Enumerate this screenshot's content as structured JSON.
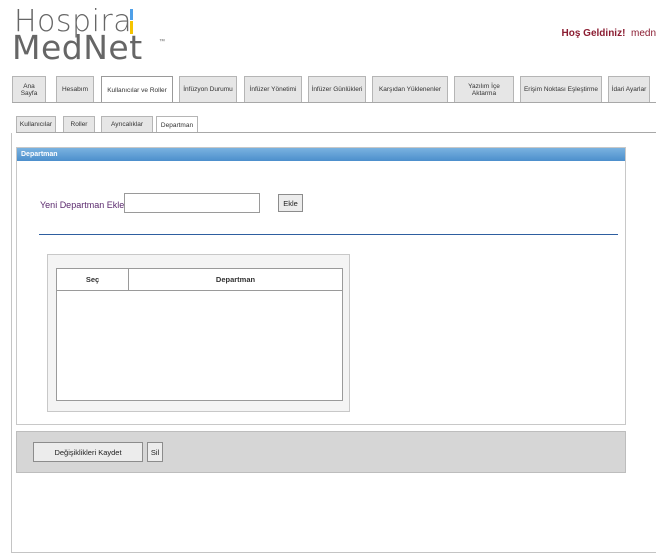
{
  "header": {
    "logo_line1": "Hospira",
    "logo_line2": "MedNet",
    "logo_tm": "™",
    "welcome_label": "Hoş Geldiniz!",
    "username": "medn"
  },
  "main_tabs": [
    {
      "label": "Ana Sayfa"
    },
    {
      "label": "Hesabım"
    },
    {
      "label": "Kullanıcılar ve Roller"
    },
    {
      "label": "İnfüzyon Durumu"
    },
    {
      "label": "İnfüzer Yönetimi"
    },
    {
      "label": "İnfüzer Günlükleri"
    },
    {
      "label": "Karşıdan Yüklenenler"
    },
    {
      "label": "Yazılım İçe Aktarma"
    },
    {
      "label": "Erişim Noktası Eşleştirme"
    },
    {
      "label": "İdari Ayarlar"
    }
  ],
  "main_tabs_active": "Kullanıcılar ve Roller",
  "sub_tabs": [
    {
      "label": "Kullanıcılar"
    },
    {
      "label": "Roller"
    },
    {
      "label": "Ayrıcalıklar"
    },
    {
      "label": "Departman"
    }
  ],
  "sub_tabs_active": "Departman",
  "panel": {
    "title": "Departman",
    "add_label": "Yeni Departman Ekle",
    "add_input_value": "",
    "add_button": "Ekle",
    "table": {
      "columns": [
        "Seç",
        "Departman"
      ],
      "rows": []
    }
  },
  "actions": {
    "save_button": "Değişiklikleri Kaydet",
    "delete_button": "Sil"
  },
  "colors": {
    "panel_header": "#5b9ad6",
    "welcome_text": "#8b1d32",
    "label_text": "#5b2a6e",
    "separator": "#2e5ea0",
    "action_bar": "#d6d6d6"
  }
}
